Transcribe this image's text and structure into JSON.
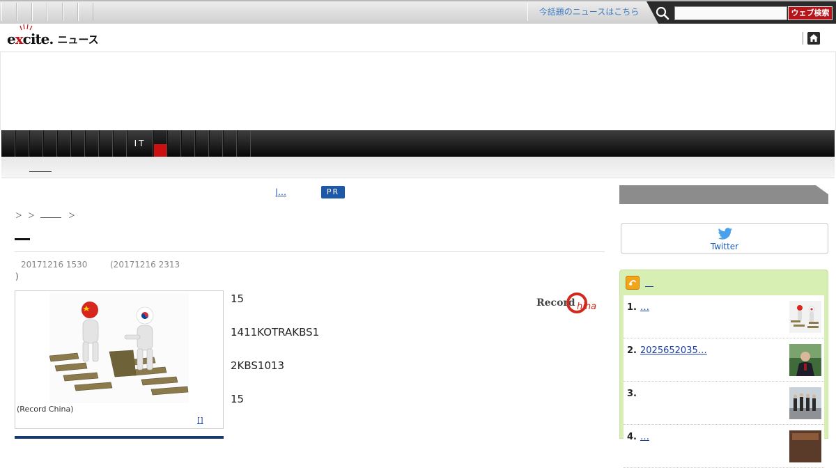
{
  "topbar": {
    "news_link": "今話題のニュースはこちら",
    "search_placeholder": "",
    "search_button": "ウェブ検索"
  },
  "logo": {
    "brand_e": "e",
    "brand_x": "x",
    "brand_rest": "cite.",
    "section": "ニュース"
  },
  "nav": {
    "categories": [
      "",
      "",
      "",
      "",
      "",
      "",
      "",
      "",
      "",
      "IT",
      "",
      "",
      "",
      "",
      "",
      "",
      ""
    ],
    "active_index": 10
  },
  "pr": {
    "link": "|…",
    "badge": "PR"
  },
  "breadcrumb": {
    "sep": "＞"
  },
  "article": {
    "date_published": "20171216 1530",
    "date_updated": "(20171216 2313",
    "date_updated_close": ")",
    "photo_caption": "(Record China)",
    "photo_more": "[]",
    "paragraphs": [
      "15",
      "1411KOTRAKBS1",
      "2KBS1013",
      "15"
    ],
    "source_logo": "Record China"
  },
  "sidebar": {
    "twitter_label": "Twitter",
    "ranking": [
      {
        "num": "1.",
        "title": "…"
      },
      {
        "num": "2.",
        "title": "2025652035…"
      },
      {
        "num": "3.",
        "title": ""
      },
      {
        "num": "4.",
        "title": "…"
      }
    ]
  },
  "colors": {
    "accent_red": "#cc0f0f",
    "link_blue": "#1a3ea8",
    "ranking_bg": "#d8efb3",
    "pr_badge": "#1e58a8"
  }
}
